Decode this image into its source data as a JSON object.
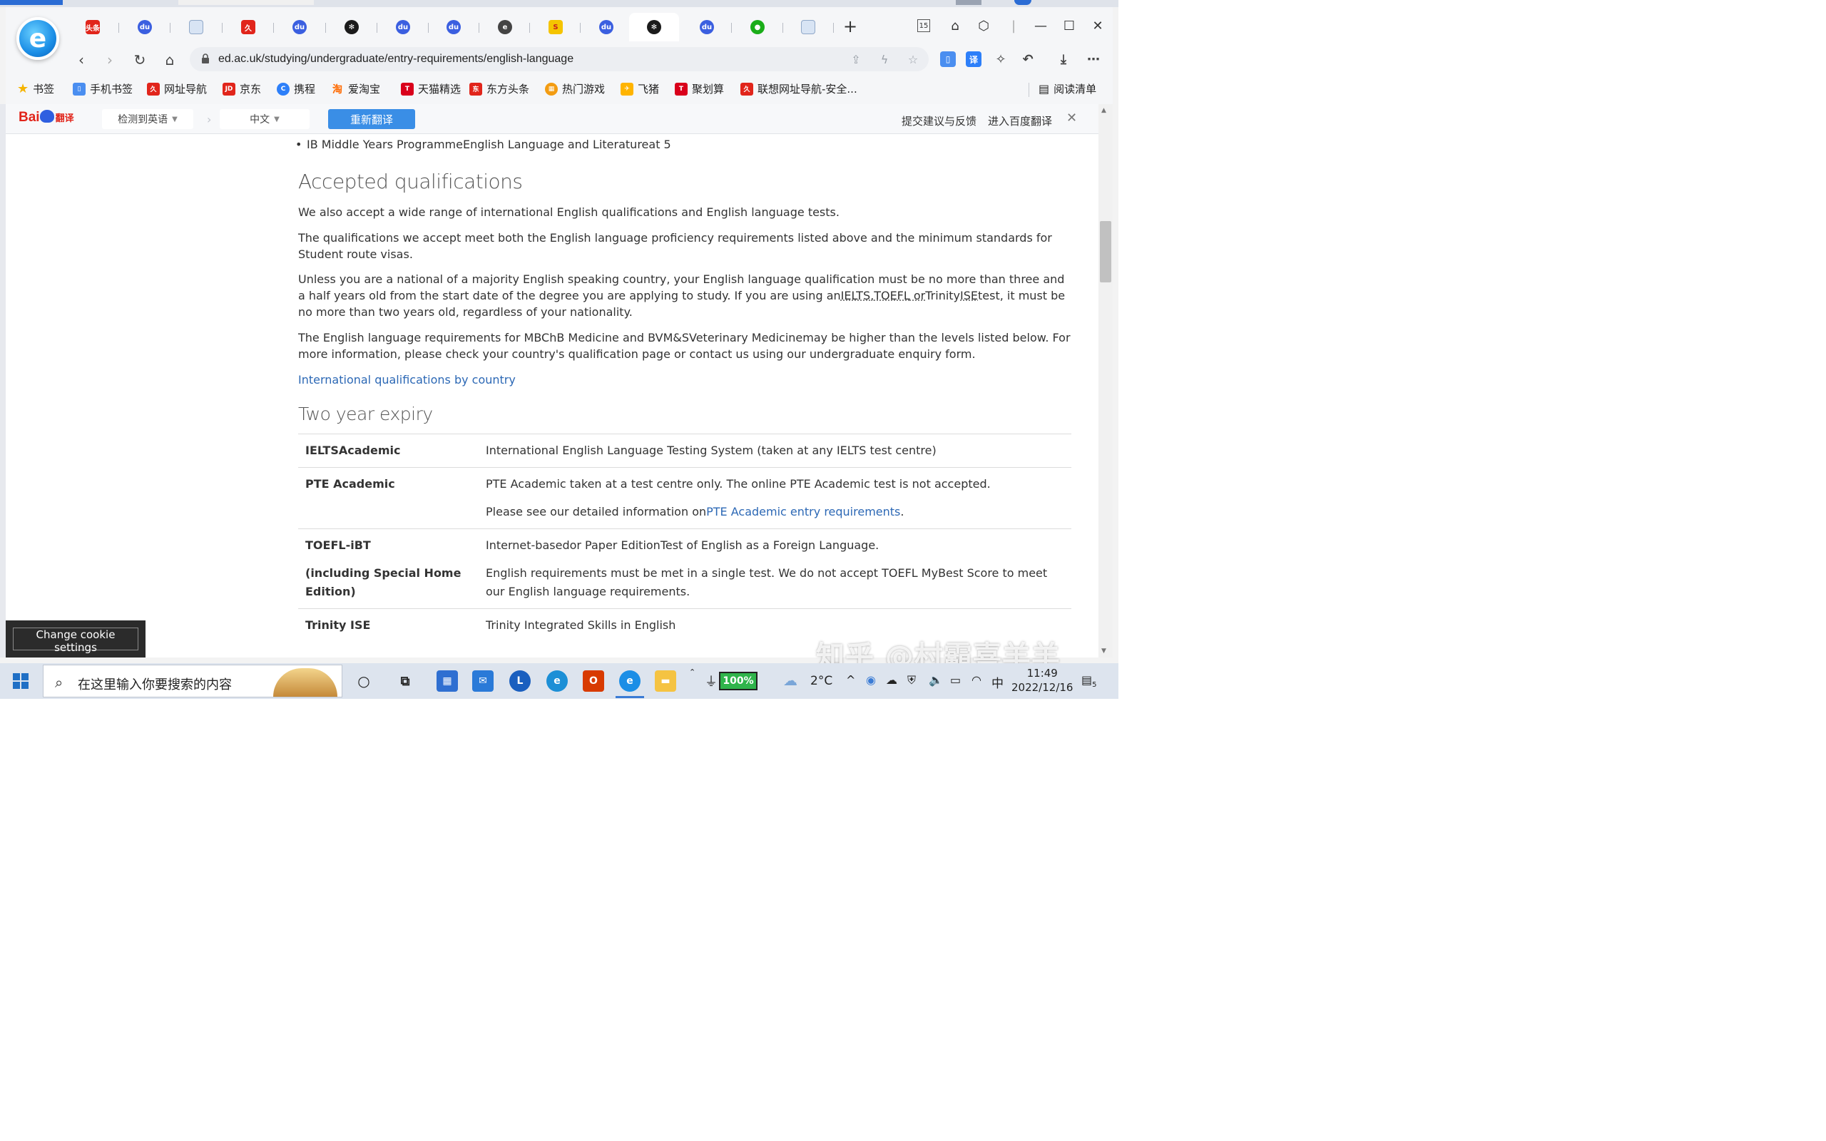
{
  "browser": {
    "url": "ed.ac.uk/studying/undergraduate/entry-requirements/english-language",
    "tab_badge": "15"
  },
  "bookmarks": [
    {
      "label": "书签",
      "color": "#f5b400"
    },
    {
      "label": "手机书签",
      "color": "#4a8ef0"
    },
    {
      "label": "网址导航",
      "color": "#e1251b"
    },
    {
      "label": "京东",
      "color": "#e1251b"
    },
    {
      "label": "携程",
      "color": "#2d7ff9"
    },
    {
      "label": "爱淘宝",
      "color": "#ff6a00"
    },
    {
      "label": "天猫精选",
      "color": "#d9001b"
    },
    {
      "label": "东方头条",
      "color": "#e1251b"
    },
    {
      "label": "热门游戏",
      "color": "#f39c12"
    },
    {
      "label": "飞猪",
      "color": "#ffb400"
    },
    {
      "label": "聚划算",
      "color": "#d9001b"
    },
    {
      "label": "联想网址导航-安全...",
      "color": "#e1251b"
    }
  ],
  "reading_list": "阅读清单",
  "translate_bar": {
    "brand": "Bai",
    "brand_suffix": "翻译",
    "source_lang": "检测到英语",
    "target_lang": "中文",
    "retranslate": "重新翻译",
    "feedback": "提交建议与反馈",
    "open_baidu": "进入百度翻译"
  },
  "page": {
    "bullet": "IB Middle Years ProgrammeEnglish Language and Literatureat 5",
    "heading_accepted": "Accepted qualifications",
    "p1": "We also accept a wide range of international English qualifications and English language tests.",
    "p2": "The qualifications we accept meet both the English language proficiency requirements listed above and the minimum standards for Student route visas.",
    "p3_a": "Unless you are a national of a majority English speaking country, your English language qualification must be no more than three and a half years old from the start date of the degree you are applying to study. If you are using an",
    "p3_ielts": "IELTS",
    "p3_sep1": ",",
    "p3_toefl": "TOEFL",
    "p3_or": " or",
    "p3_trinity": "Trinity",
    "p3_ise": "ISE",
    "p3_b": "test, it must be no more than two years old, regardless of your nationality.",
    "p4": "The English language requirements for MBChB Medicine and BVM&SVeterinary Medicinemay be higher than the levels listed below. For more information, please check your country's qualification page or contact us using our undergraduate enquiry form.",
    "link_intl": "International qualifications by country",
    "heading_two_year": "Two year expiry",
    "table": [
      {
        "key": "IELTSAcademic",
        "values": [
          "International English Language Testing System (taken at any IELTS test centre)"
        ]
      },
      {
        "key": "PTE Academic",
        "values": [
          "PTE Academic taken at a test centre only. The online PTE Academic test is not accepted."
        ],
        "extra_pre": "Please see our detailed information on",
        "extra_link": "PTE Academic entry requirements",
        "extra_post": "."
      },
      {
        "key": "TOEFL-iBT",
        "key2": "(including Special Home Edition)",
        "values": [
          "Internet-basedor Paper EditionTest of English as a Foreign Language.",
          "English requirements must be met in a single test. We do not accept TOEFL MyBest Score to meet our English language requirements."
        ]
      },
      {
        "key": "Trinity ISE",
        "values": [
          "Trinity Integrated Skills in English"
        ]
      }
    ]
  },
  "cookie_button": "Change cookie settings",
  "watermark": "知乎 @村霸喜羊羊",
  "taskbar": {
    "search_placeholder": "在这里输入你要搜索的内容",
    "battery": "100%",
    "temperature": "2°C",
    "ime": "中",
    "time": "11:49",
    "date": "2022/12/16",
    "notification_count": "5"
  }
}
